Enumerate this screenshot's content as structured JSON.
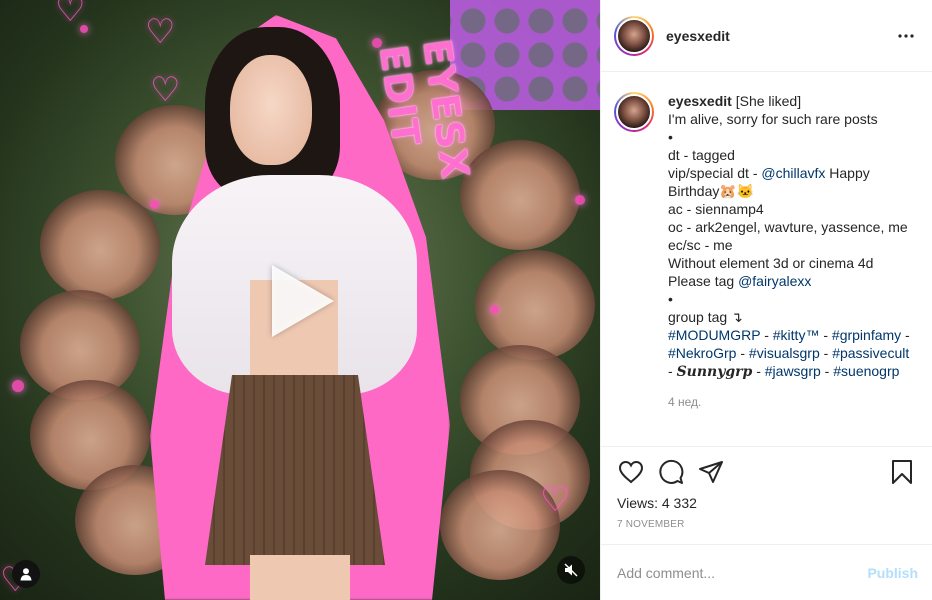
{
  "post": {
    "username": "eyesxedit",
    "watermark": "EYESX EDIT",
    "caption": {
      "username": "eyesxedit",
      "lines": [
        {
          "text": "[She liked]"
        },
        {
          "text": "I'm alive, sorry for such rare posts"
        },
        {
          "text": "•"
        },
        {
          "text": "dt - tagged"
        }
      ],
      "vip_prefix": "vip/special dt - ",
      "vip_mention": "@chillavfx",
      "vip_suffix": " Happy Birthday",
      "birthday_emoji": "🐹🐱",
      "ac_line": "ac - siennamp4",
      "oc_line": "oc - ark2engel, wavture, yassence, me",
      "ec_line": "ec/sc - me",
      "without_line": "Without element 3d or cinema 4d",
      "tag_prefix": "Please tag ",
      "tag_mention": "@fairyalexx",
      "bullet2": "•",
      "group_tag": "group tag ↴",
      "groups": {
        "g1": "#MODUMGRP",
        "g2": "#kitty™",
        "g3": "#grpinfamy",
        "g4": "#NekroGrp",
        "g5": "#visualsgrp",
        "g6": "#passivecult",
        "g7": "𝑺𝒖𝒏𝒏𝒚𝒈𝒓𝒑",
        "g8": "#jawsgrp",
        "g9": "#suenogrp"
      },
      "sep": " - ",
      "time_ago": "4 нед."
    },
    "views_label": "Views: 4 332",
    "date": "7 NOVEMBER",
    "add_comment_placeholder": "Add comment...",
    "publish_label": "Publish"
  },
  "icons": {
    "like": "heart-icon",
    "comment": "comment-icon",
    "share": "share-icon",
    "save": "bookmark-icon",
    "more": "more-icon",
    "play": "play-icon",
    "tag": "user-tag-icon",
    "mute": "muted-speaker-icon"
  },
  "colors": {
    "link": "#00376b",
    "publish_disabled": "#b2dffc",
    "watermark_pink": "#ff6fd0"
  }
}
